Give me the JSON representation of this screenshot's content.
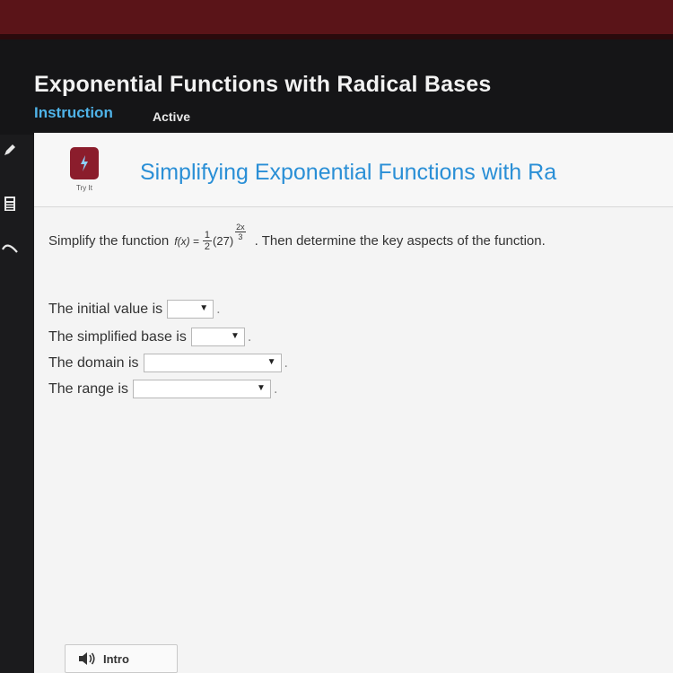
{
  "header": {
    "course_title": "Exponential Functions with Radical Bases",
    "tabs": [
      {
        "label": "Instruction"
      },
      {
        "label": "Active"
      }
    ]
  },
  "activity": {
    "badge_label": "Try It",
    "title": "Simplifying Exponential Functions with Ra"
  },
  "problem": {
    "prompt_before": "Simplify the function",
    "function_name": "f(x) =",
    "coefficient_num": "1",
    "coefficient_den": "2",
    "base": "(27)",
    "exponent_num": "2x",
    "exponent_den": "3",
    "prompt_after": ". Then determine the key aspects of the function."
  },
  "answers": [
    {
      "label": "The initial value is",
      "selected": ""
    },
    {
      "label": "The simplified base is",
      "selected": ""
    },
    {
      "label": "The domain is",
      "selected": ""
    },
    {
      "label": "The range is",
      "selected": ""
    }
  ],
  "footer": {
    "intro_label": "Intro"
  },
  "colors": {
    "accent": "#4fb3e8",
    "title_blue": "#2a8fd6",
    "badge": "#8b1d2c"
  }
}
